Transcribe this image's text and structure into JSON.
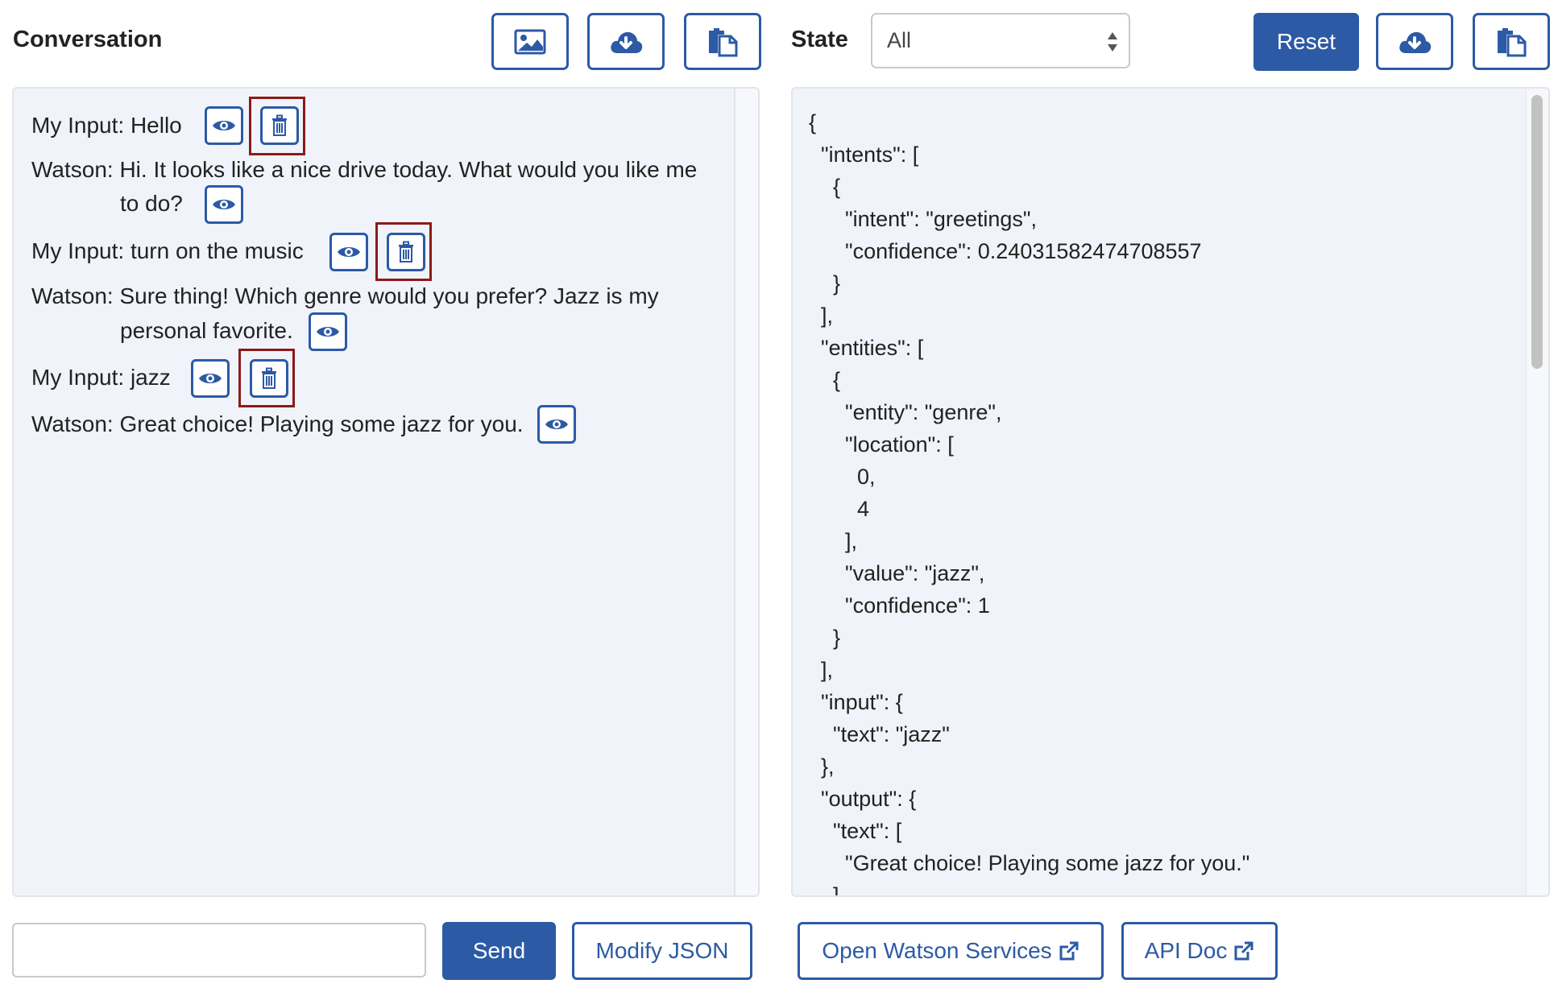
{
  "conversation": {
    "title": "Conversation",
    "toolbar_icons": [
      "image-icon",
      "cloud-download-icon",
      "clipboard-icon"
    ]
  },
  "state": {
    "title": "State",
    "filter_value": "All",
    "reset_label": "Reset"
  },
  "messages": [
    {
      "speaker": "My Input:",
      "text": " Hello"
    },
    {
      "speaker": "Watson:",
      "text": " Hi. It looks like a nice drive today. What would you like me",
      "cont": "to do?"
    },
    {
      "speaker": "My Input:",
      "text": " turn on the music"
    },
    {
      "speaker": "Watson:",
      "text": " Sure thing! Which genre would you prefer? Jazz is my",
      "cont": "personal favorite."
    },
    {
      "speaker": "My Input:",
      "text": " jazz"
    },
    {
      "speaker": "Watson:",
      "text": " Great choice! Playing some jazz for you."
    }
  ],
  "json_lines": [
    "{",
    "  \"intents\": [",
    "    {",
    "      \"intent\": \"greetings\",",
    "      \"confidence\": 0.24031582474708557",
    "    }",
    "  ],",
    "  \"entities\": [",
    "    {",
    "      \"entity\": \"genre\",",
    "      \"location\": [",
    "        0,",
    "        4",
    "      ],",
    "      \"value\": \"jazz\",",
    "      \"confidence\": 1",
    "    }",
    "  ],",
    "  \"input\": {",
    "    \"text\": \"jazz\"",
    "  },",
    "  \"output\": {",
    "    \"text\": [",
    "      \"Great choice! Playing some jazz for you.\"",
    "    ]"
  ],
  "footer": {
    "input_value": "",
    "send_label": "Send",
    "modify_label": "Modify JSON",
    "open_services_label": "Open Watson Services",
    "api_doc_label": "API Doc"
  },
  "colors": {
    "accent": "#2c5aa5",
    "highlight_box": "#8b1a1a",
    "panel_bg": "#f0f3f9"
  }
}
